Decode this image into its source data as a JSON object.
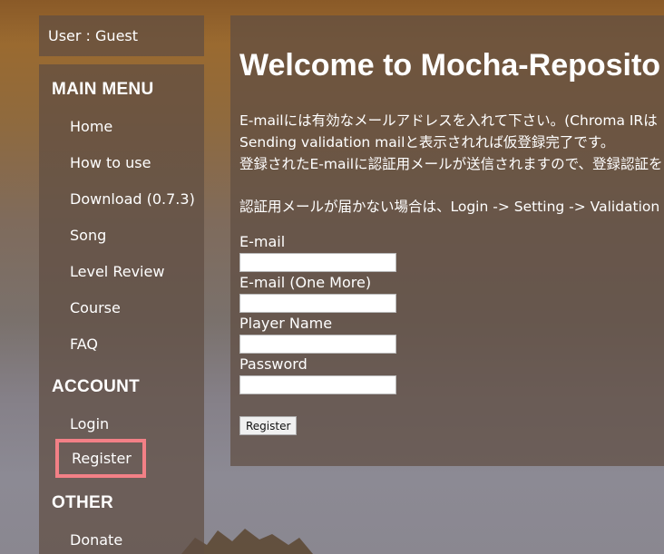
{
  "user": {
    "label": "User : Guest"
  },
  "sidebar": {
    "main_menu_heading": "MAIN MENU",
    "main_menu_items": [
      {
        "label": "Home"
      },
      {
        "label": "How to use"
      },
      {
        "label": "Download (0.7.3)"
      },
      {
        "label": "Song"
      },
      {
        "label": "Level Review"
      },
      {
        "label": "Course"
      },
      {
        "label": "FAQ"
      }
    ],
    "account_heading": "ACCOUNT",
    "account_items": [
      {
        "label": "Login"
      },
      {
        "label": "Register"
      }
    ],
    "other_heading": "OTHER",
    "other_items": [
      {
        "label": "Donate"
      }
    ]
  },
  "main": {
    "title": "Welcome to Mocha-Reposito",
    "info_lines": [
      "E-mailには有効なメールアドレスを入れて下さい。(Chroma IRは",
      "Sending validation mailと表示されれば仮登録完了です。",
      "登録されたE-mailに認証用メールが送信されますので、登録認証を",
      "認証用メールが届かない場合は、Login -> Setting -> Validation"
    ],
    "form": {
      "email_label": "E-mail",
      "email_value": "",
      "email_confirm_label": "E-mail (One More)",
      "email_confirm_value": "",
      "player_name_label": "Player Name",
      "player_name_value": "",
      "password_label": "Password",
      "password_value": "",
      "submit_label": "Register"
    }
  },
  "colors": {
    "panel": "#5f4e42",
    "highlight_border": "#f28086",
    "text": "#ffffff"
  }
}
